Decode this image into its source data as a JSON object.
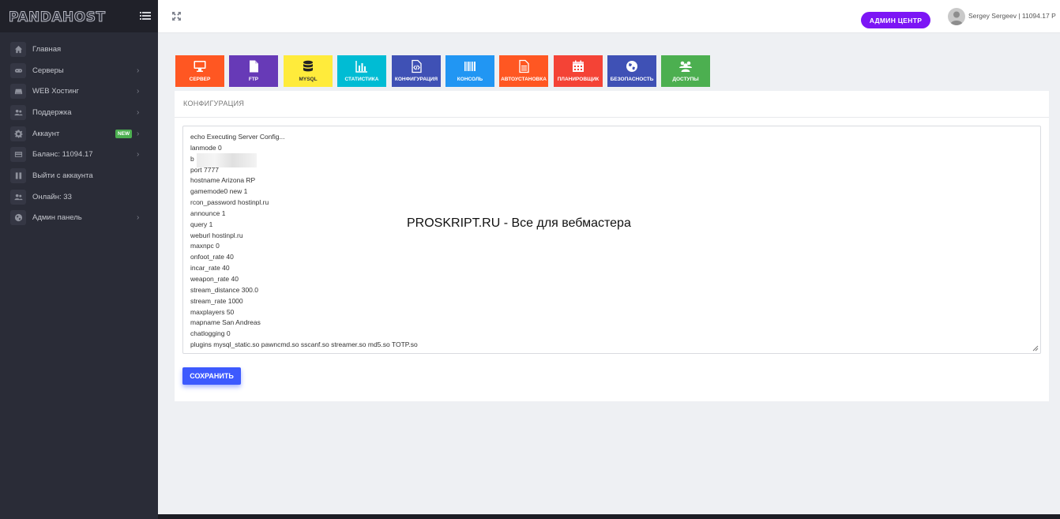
{
  "brand": {
    "logo": "PANDAHOST"
  },
  "sidebar": {
    "items": [
      {
        "label": "Главная",
        "icon": "home-icon",
        "chevron": false
      },
      {
        "label": "Серверы",
        "icon": "gamepad-icon",
        "chevron": true
      },
      {
        "label": "WEB Хостинг",
        "icon": "server-icon",
        "chevron": true
      },
      {
        "label": "Поддержка",
        "icon": "users-icon",
        "chevron": true
      },
      {
        "label": "Аккаунт",
        "icon": "gear-icon",
        "chevron": true,
        "badge": "NEW"
      },
      {
        "label": "Баланс: 11094.17",
        "icon": "credit-card-icon",
        "chevron": true
      },
      {
        "label": "Выйти с аккаунта",
        "icon": "pause-icon",
        "chevron": false
      },
      {
        "label": "Онлайн: 33",
        "icon": "users-icon",
        "chevron": false
      },
      {
        "label": "Админ панель",
        "icon": "globe-icon",
        "chevron": true
      }
    ]
  },
  "topbar": {
    "admin_button": "АДМИН ЦЕНТР",
    "user_name": "Sergey Sergeev | 11094.17 Р"
  },
  "tabs": [
    {
      "label": "СЕРВЕР",
      "color": "#ff5722",
      "icon": "monitor-icon"
    },
    {
      "label": "FTP",
      "color": "#673ab7",
      "icon": "file-icon"
    },
    {
      "label": "MYSQL",
      "color": "#ffeb3b",
      "icon": "database-icon"
    },
    {
      "label": "СТАТИСТИКА",
      "color": "#00bcd4",
      "icon": "bar-chart-icon"
    },
    {
      "label": "КОНФИГУРАЦИЯ",
      "color": "#3f51b5",
      "icon": "code-file-icon"
    },
    {
      "label": "КОНСОЛЬ",
      "color": "#2196f3",
      "icon": "barcode-icon"
    },
    {
      "label": "АВТОУСТАНОВКА",
      "color": "#ff5722",
      "icon": "document-icon"
    },
    {
      "label": "ПЛАНИРОВЩИК",
      "color": "#f44336",
      "icon": "calendar-icon"
    },
    {
      "label": "БЕЗОПАСНОСТЬ",
      "color": "#3f51b5",
      "icon": "globe-icon"
    },
    {
      "label": "ДОСТУПЫ",
      "color": "#4caf50",
      "icon": "users-icon"
    }
  ],
  "panel": {
    "title": "КОНФИГУРАЦИЯ",
    "config_lines": [
      "echo Executing Server Config...",
      "lanmode 0",
      "b",
      "port 7777",
      "hostname Arizona RP",
      "gamemode0 new 1",
      "rcon_password hostinpl.ru",
      "announce 1",
      "query 1",
      "weburl hostinpl.ru",
      "maxnpc 0",
      "onfoot_rate 40",
      "incar_rate 40",
      "weapon_rate 40",
      "stream_distance 300.0",
      "stream_rate 1000",
      "maxplayers 50",
      "mapname San Andreas",
      "chatlogging 0",
      "plugins mysql_static.so pawncmd.so sscanf.so streamer.so md5.so TOTP.so"
    ],
    "save_button": "СОХРАНИТЬ"
  },
  "watermark": "PROSKRIPT.RU - Все для вебмастера"
}
